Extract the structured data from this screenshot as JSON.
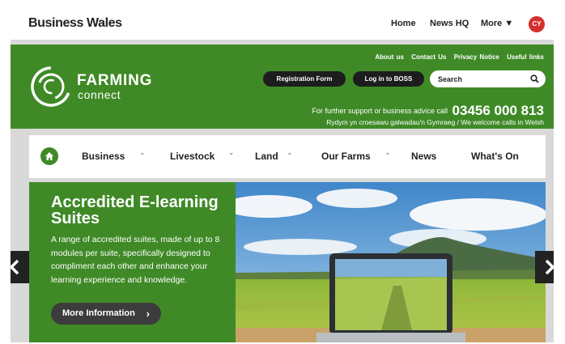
{
  "topbar": {
    "brand": "Business Wales",
    "nav": [
      "Home",
      "News HQ",
      "More ▼"
    ],
    "language_badge": "CY"
  },
  "header": {
    "logo_name": "FARMING",
    "logo_sub": "connect",
    "util_links": [
      "About us",
      "Contact Us",
      "Privacy Notice",
      "Useful links"
    ],
    "registration_label": "Registration Form",
    "login_label": "Log in to BOSS",
    "search_placeholder": "Search",
    "support_text": "For further support or business advice call",
    "phone": "03456 000 813",
    "welsh_text": "Rydym yn croesawu galwadau'n Gymraeg / We welcome calls in Welsh"
  },
  "mainnav": {
    "items": [
      "Business",
      "Livestock",
      "Land",
      "Our Farms",
      "News",
      "What's On"
    ]
  },
  "hero": {
    "title": "Accredited E-learning Suites",
    "description": "A range of accredited suites, made of up to 8 modules per suite, specifically designed to compliment each other and enhance your learning experience and knowledge.",
    "button_label": "More Information"
  },
  "icons": {
    "home": "home-icon",
    "search": "search-icon",
    "prev": "chevron-left-icon",
    "next": "chevron-right-icon",
    "logo": "farming-connect-logo-icon"
  },
  "colors": {
    "brand_green": "#3f8a27",
    "badge_red": "#d4302e",
    "dark_button": "#1d1d1d"
  }
}
